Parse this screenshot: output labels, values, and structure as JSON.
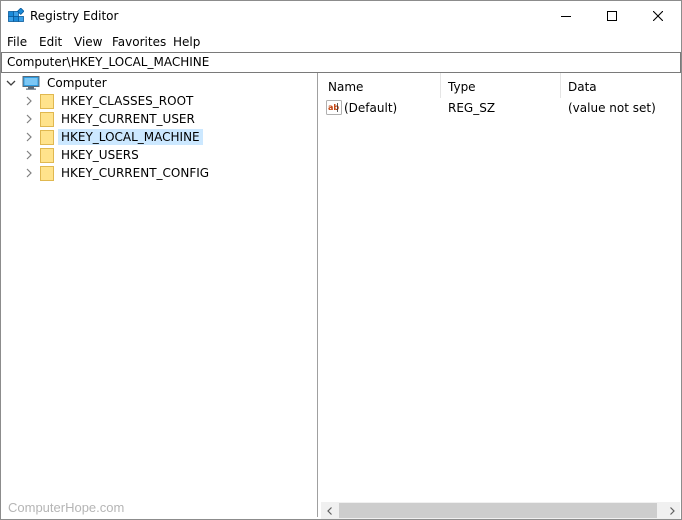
{
  "window": {
    "title": "Registry Editor",
    "icon": "registry-editor-icon"
  },
  "menu": [
    "File",
    "Edit",
    "View",
    "Favorites",
    "Help"
  ],
  "address": "Computer\\HKEY_LOCAL_MACHINE",
  "tree": {
    "root": "Computer",
    "items": [
      {
        "label": "HKEY_CLASSES_ROOT",
        "selected": false
      },
      {
        "label": "HKEY_CURRENT_USER",
        "selected": false
      },
      {
        "label": "HKEY_LOCAL_MACHINE",
        "selected": true
      },
      {
        "label": "HKEY_USERS",
        "selected": false
      },
      {
        "label": "HKEY_CURRENT_CONFIG",
        "selected": false
      }
    ]
  },
  "list": {
    "columns": [
      "Name",
      "Type",
      "Data"
    ],
    "rows": [
      {
        "name": "(Default)",
        "type": "REG_SZ",
        "data": "(value not set)",
        "icon": "string-value-icon"
      }
    ]
  },
  "watermark": "ComputerHope.com",
  "colors": {
    "selection": "#cce8ff",
    "folder": "#ffe38c",
    "accent": "#0078d7"
  }
}
